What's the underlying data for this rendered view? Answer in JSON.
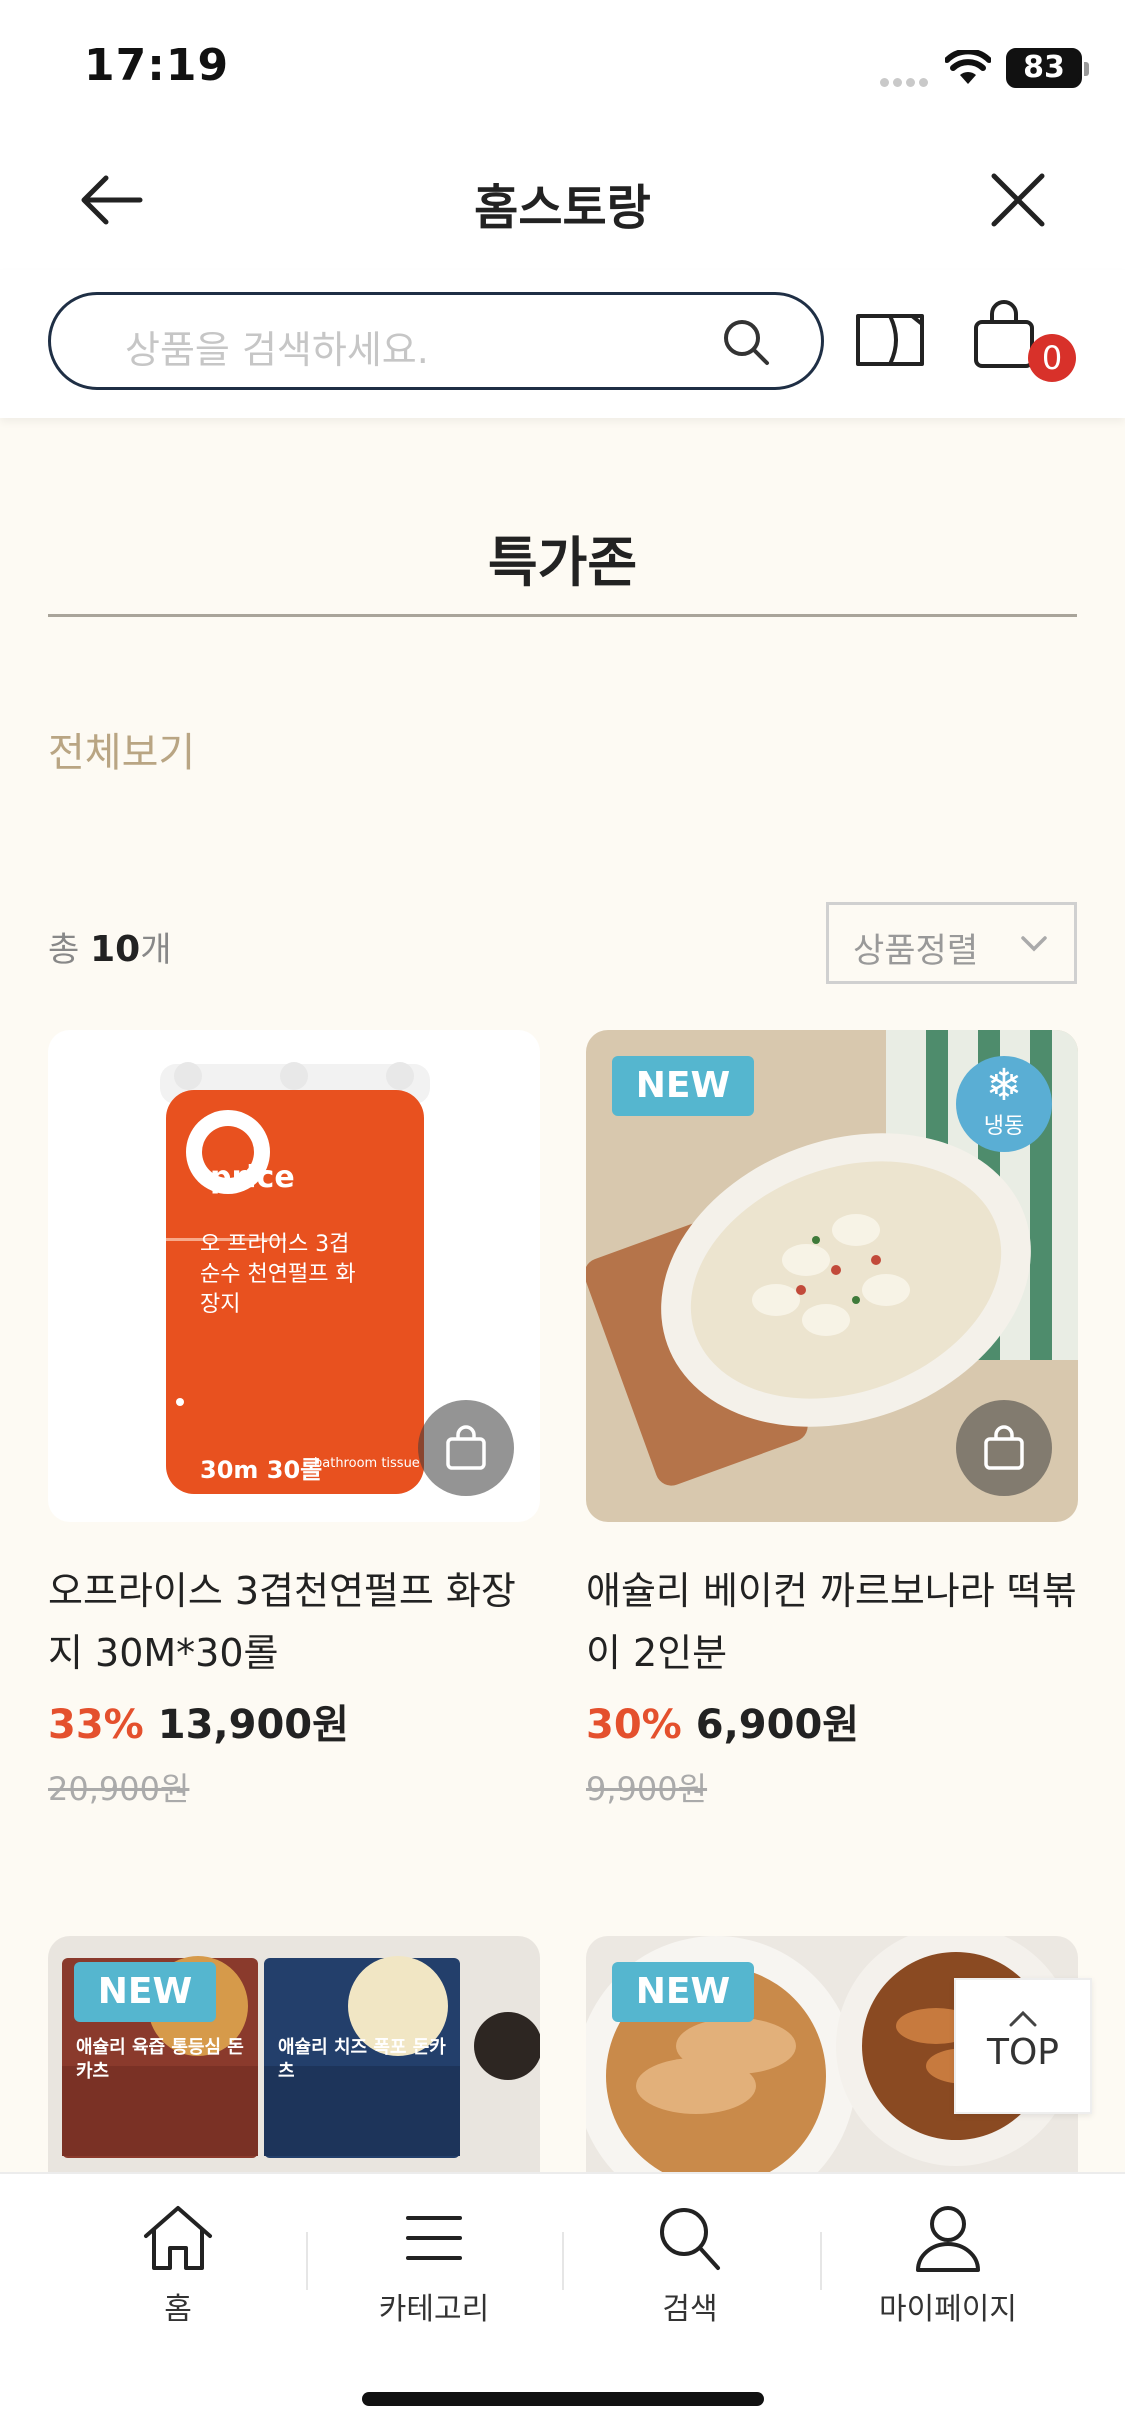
{
  "status_bar": {
    "time": "17:19",
    "battery": "83"
  },
  "header": {
    "title": "홈스토랑"
  },
  "search": {
    "placeholder": "상품을 검색하세요.",
    "cart_count": "0"
  },
  "section": {
    "title": "특가존",
    "view_all": "전체보기"
  },
  "list": {
    "total_prefix": "총",
    "total_count": "10",
    "total_suffix": "개",
    "sort_label": "상품정렬"
  },
  "products": [
    {
      "name": "오프라이스 3겹천연펄프 화장지 30M*30롤",
      "discount": "33%",
      "price": "13,900원",
      "original_price": "20,900원",
      "badge": "",
      "pack_brand": "price",
      "pack_text": "오 프라이스 3겹 순수 천연펄프 화장지",
      "pack_size": "30m 30롤",
      "pack_sub": "bathroom tissue"
    },
    {
      "name": "애슐리 베이컨 까르보나라 떡볶이 2인분",
      "discount": "30%",
      "price": "6,900원",
      "original_price": "9,900원",
      "badge": "NEW",
      "frozen_label": "냉동"
    },
    {
      "badge": "NEW",
      "pack_labels": [
        "애슐리 육즙 통등심 돈카츠",
        "애슐리 치즈 폭포 돈카츠"
      ]
    },
    {
      "badge": "NEW"
    }
  ],
  "top_button": {
    "label": "TOP"
  },
  "tabbar": {
    "items": [
      {
        "label": "홈"
      },
      {
        "label": "카테고리"
      },
      {
        "label": "검색"
      },
      {
        "label": "마이페이지"
      }
    ]
  },
  "colors": {
    "accent": "#e4502d",
    "badge_new": "#55b6cf",
    "cart_badge": "#d8312a",
    "view_all": "#b9a583"
  }
}
